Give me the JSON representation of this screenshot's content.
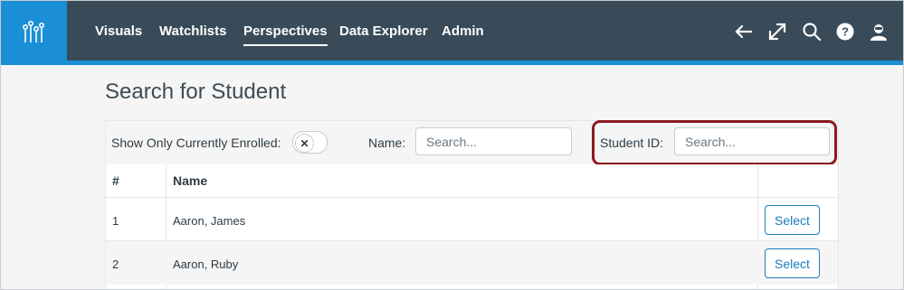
{
  "nav": {
    "logo_icon": "lines-nodes-icon",
    "items": [
      {
        "label": "Visuals",
        "active": false
      },
      {
        "label": "Watchlists",
        "active": false
      },
      {
        "label": "Perspectives",
        "active": true
      },
      {
        "label": "Data Explorer",
        "active": false
      },
      {
        "label": "Admin",
        "active": false
      }
    ],
    "right_icons": [
      "arrow-left-icon",
      "expand-icon",
      "search-icon",
      "help-icon",
      "user-icon"
    ],
    "colors": {
      "bar": "#394b58",
      "accent": "#1b8fd6"
    }
  },
  "page": {
    "title": "Search for Student"
  },
  "filters": {
    "enrolled_label": "Show Only Currently Enrolled:",
    "enrolled_toggle_symbol": "✕",
    "name_label": "Name:",
    "name_placeholder": "Search...",
    "student_id_label": "Student ID:",
    "student_id_placeholder": "Search..."
  },
  "table": {
    "headers": [
      "#",
      "Name",
      ""
    ],
    "rows": [
      {
        "num": "1",
        "name": "Aaron, James",
        "action": "Select"
      },
      {
        "num": "2",
        "name": "Aaron, Ruby",
        "action": "Select"
      }
    ]
  }
}
